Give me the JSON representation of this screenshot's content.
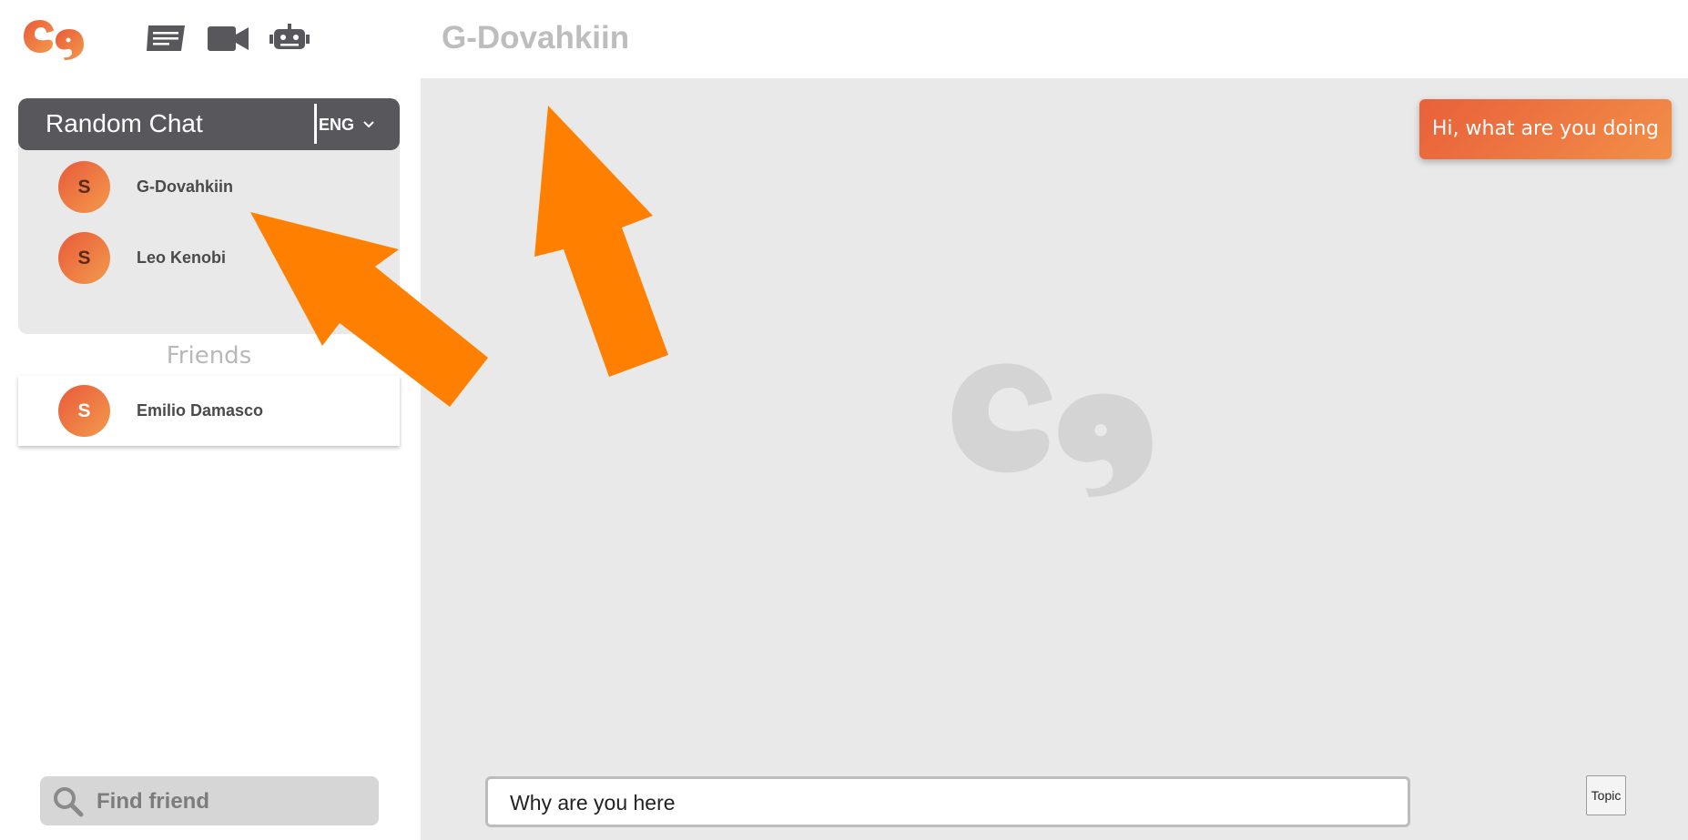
{
  "app": {
    "logo_icon": "eg-logo-icon",
    "brand_gradient": [
      "#e85a3a",
      "#f39a4c"
    ]
  },
  "topbar": {
    "icons": [
      "chat-list-icon",
      "video-camera-icon",
      "robot-icon"
    ],
    "chat_title": "G-Dovahkiin"
  },
  "random_chat": {
    "title": "Random Chat",
    "language": "ENG",
    "users": [
      {
        "name": "G-Dovahkiin",
        "initial": "S"
      },
      {
        "name": "Leo Kenobi",
        "initial": "S"
      }
    ]
  },
  "friends": {
    "heading": "Friends",
    "items": [
      {
        "name": "Emilio Damasco",
        "initial": "S"
      }
    ]
  },
  "search": {
    "placeholder": "Find friend",
    "value": ""
  },
  "chat": {
    "messages": [
      {
        "text": "Hi, what are you doing",
        "from": "me"
      }
    ],
    "input_value": "Why are you here",
    "topic_label": "Topic"
  },
  "colors": {
    "header_bg": "#58585c",
    "panel_bg": "#e9e9e9",
    "arrow": "#ff8000"
  }
}
